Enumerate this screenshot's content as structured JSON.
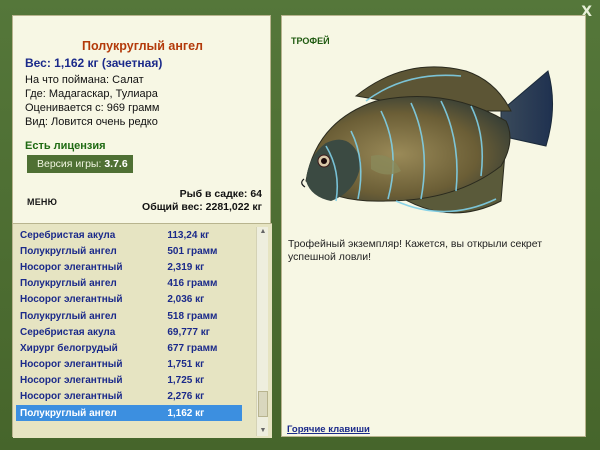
{
  "window": {
    "close_label": "X"
  },
  "fish": {
    "title": "Полукруглый ангел",
    "weight": "Вес: 1,162 кг (зачетная)",
    "bait": "На что поймана: Салат",
    "location": "Где: Мадагаскар, Тулиара",
    "valued": "Оценивается с: 969 грамм",
    "rarity": "Вид: Ловится очень редко"
  },
  "license": "Есть лицензия",
  "version": {
    "label": "Версия игры:",
    "value": "3.7.6"
  },
  "menu_label": "МЕНЮ",
  "summary": {
    "fish_in_tank": "Рыб в садке: 64",
    "total_weight": "Общий вес: 2281,022 кг"
  },
  "catch_list": [
    {
      "name": "Серебристая акула",
      "weight": "113,24 кг"
    },
    {
      "name": "Полукруглый ангел",
      "weight": "501 грамм"
    },
    {
      "name": "Носорог элегантный",
      "weight": "2,319 кг"
    },
    {
      "name": "Полукруглый ангел",
      "weight": "416 грамм"
    },
    {
      "name": "Носорог элегантный",
      "weight": "2,036 кг"
    },
    {
      "name": "Полукруглый ангел",
      "weight": "518 грамм"
    },
    {
      "name": "Серебристая акула",
      "weight": "69,777 кг"
    },
    {
      "name": "Хирург белогрудый",
      "weight": "677 грамм"
    },
    {
      "name": "Носорог элегантный",
      "weight": "1,751 кг"
    },
    {
      "name": "Носорог элегантный",
      "weight": "1,725 кг"
    },
    {
      "name": "Носорог элегантный",
      "weight": "2,276 кг"
    },
    {
      "name": "Полукруглый ангел",
      "weight": "1,162 кг"
    }
  ],
  "selected_index": 11,
  "trophy": {
    "label": "ТРОФЕЙ",
    "text": "Трофейный экземпляр! Кажется, вы открыли секрет успешной ловли!"
  },
  "hotkeys_label": "Горячие клавиши",
  "colors": {
    "frame": "#4a6a2e",
    "panel": "#f7f7e4",
    "list_bg": "#e6e4c2",
    "title": "#b33a0a",
    "link": "#1b2a8a",
    "selected": "#3c8fe0"
  }
}
